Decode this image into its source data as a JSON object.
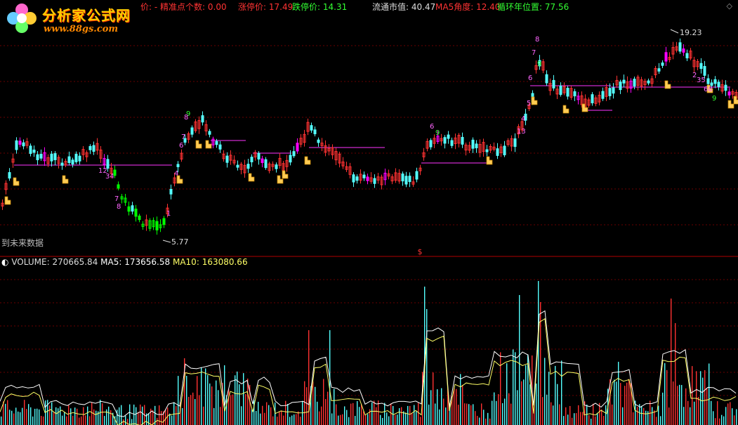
{
  "header": {
    "partial_label": "价: - 精准点个数:",
    "precise_count": "0.00",
    "limit_up_label": "涨停价:",
    "limit_up": "17.49",
    "limit_down_label": "跌停价:",
    "limit_down": "14.31",
    "float_cap_label": "流通市值:",
    "float_cap": "40.47",
    "ma5_angle_label": "MA5角度:",
    "ma5_angle": "12.40",
    "cycle_label": "循环年位置:",
    "cycle_pos": "77.56",
    "expand_icon": "diamond-icon"
  },
  "logo": {
    "title": "分析家公式网",
    "url": "www.88gs.com"
  },
  "price_pane": {
    "no_future_label": "到未来数据",
    "high_label": "19.23",
    "low_label": "5.77",
    "marker_icon": "hand-pointer-icon",
    "separator_marker": "$"
  },
  "volume_pane": {
    "volume_label": "VOLUME:",
    "volume_value": "270665.84",
    "ma5_label": "MA5:",
    "ma5_value": "173656.58",
    "ma10_label": "MA10:",
    "ma10_value": "163080.66"
  },
  "colors": {
    "up": "#ff3232",
    "down": "#54ffff",
    "ma_white": "#ffffff",
    "ma_yellow": "#ffff66",
    "magenta": "#ff00ff",
    "green": "#00ff00",
    "orange": "#ff9900",
    "grid": "#8a0000"
  },
  "chart_data": {
    "type": "candlestick",
    "price_high": 19.23,
    "price_low": 5.77,
    "volume_last": 270665.84,
    "volume_ma5": 173656.58,
    "volume_ma10": 163080.66
  }
}
